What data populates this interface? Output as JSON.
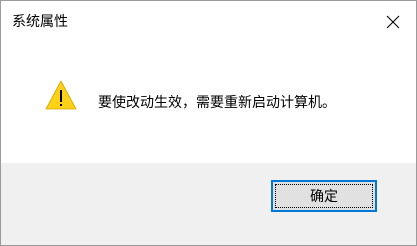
{
  "window": {
    "title": "系统属性",
    "close_icon": "close-icon"
  },
  "dialog": {
    "icon": "warning-icon",
    "message": "要使改动生效，需要重新启动计算机。",
    "ok_label": "确定"
  },
  "colors": {
    "accent": "#0078d7",
    "warning_fill": "#fcd116",
    "footer_bg": "#f0f0f0",
    "button_bg": "#e1e1e1"
  }
}
